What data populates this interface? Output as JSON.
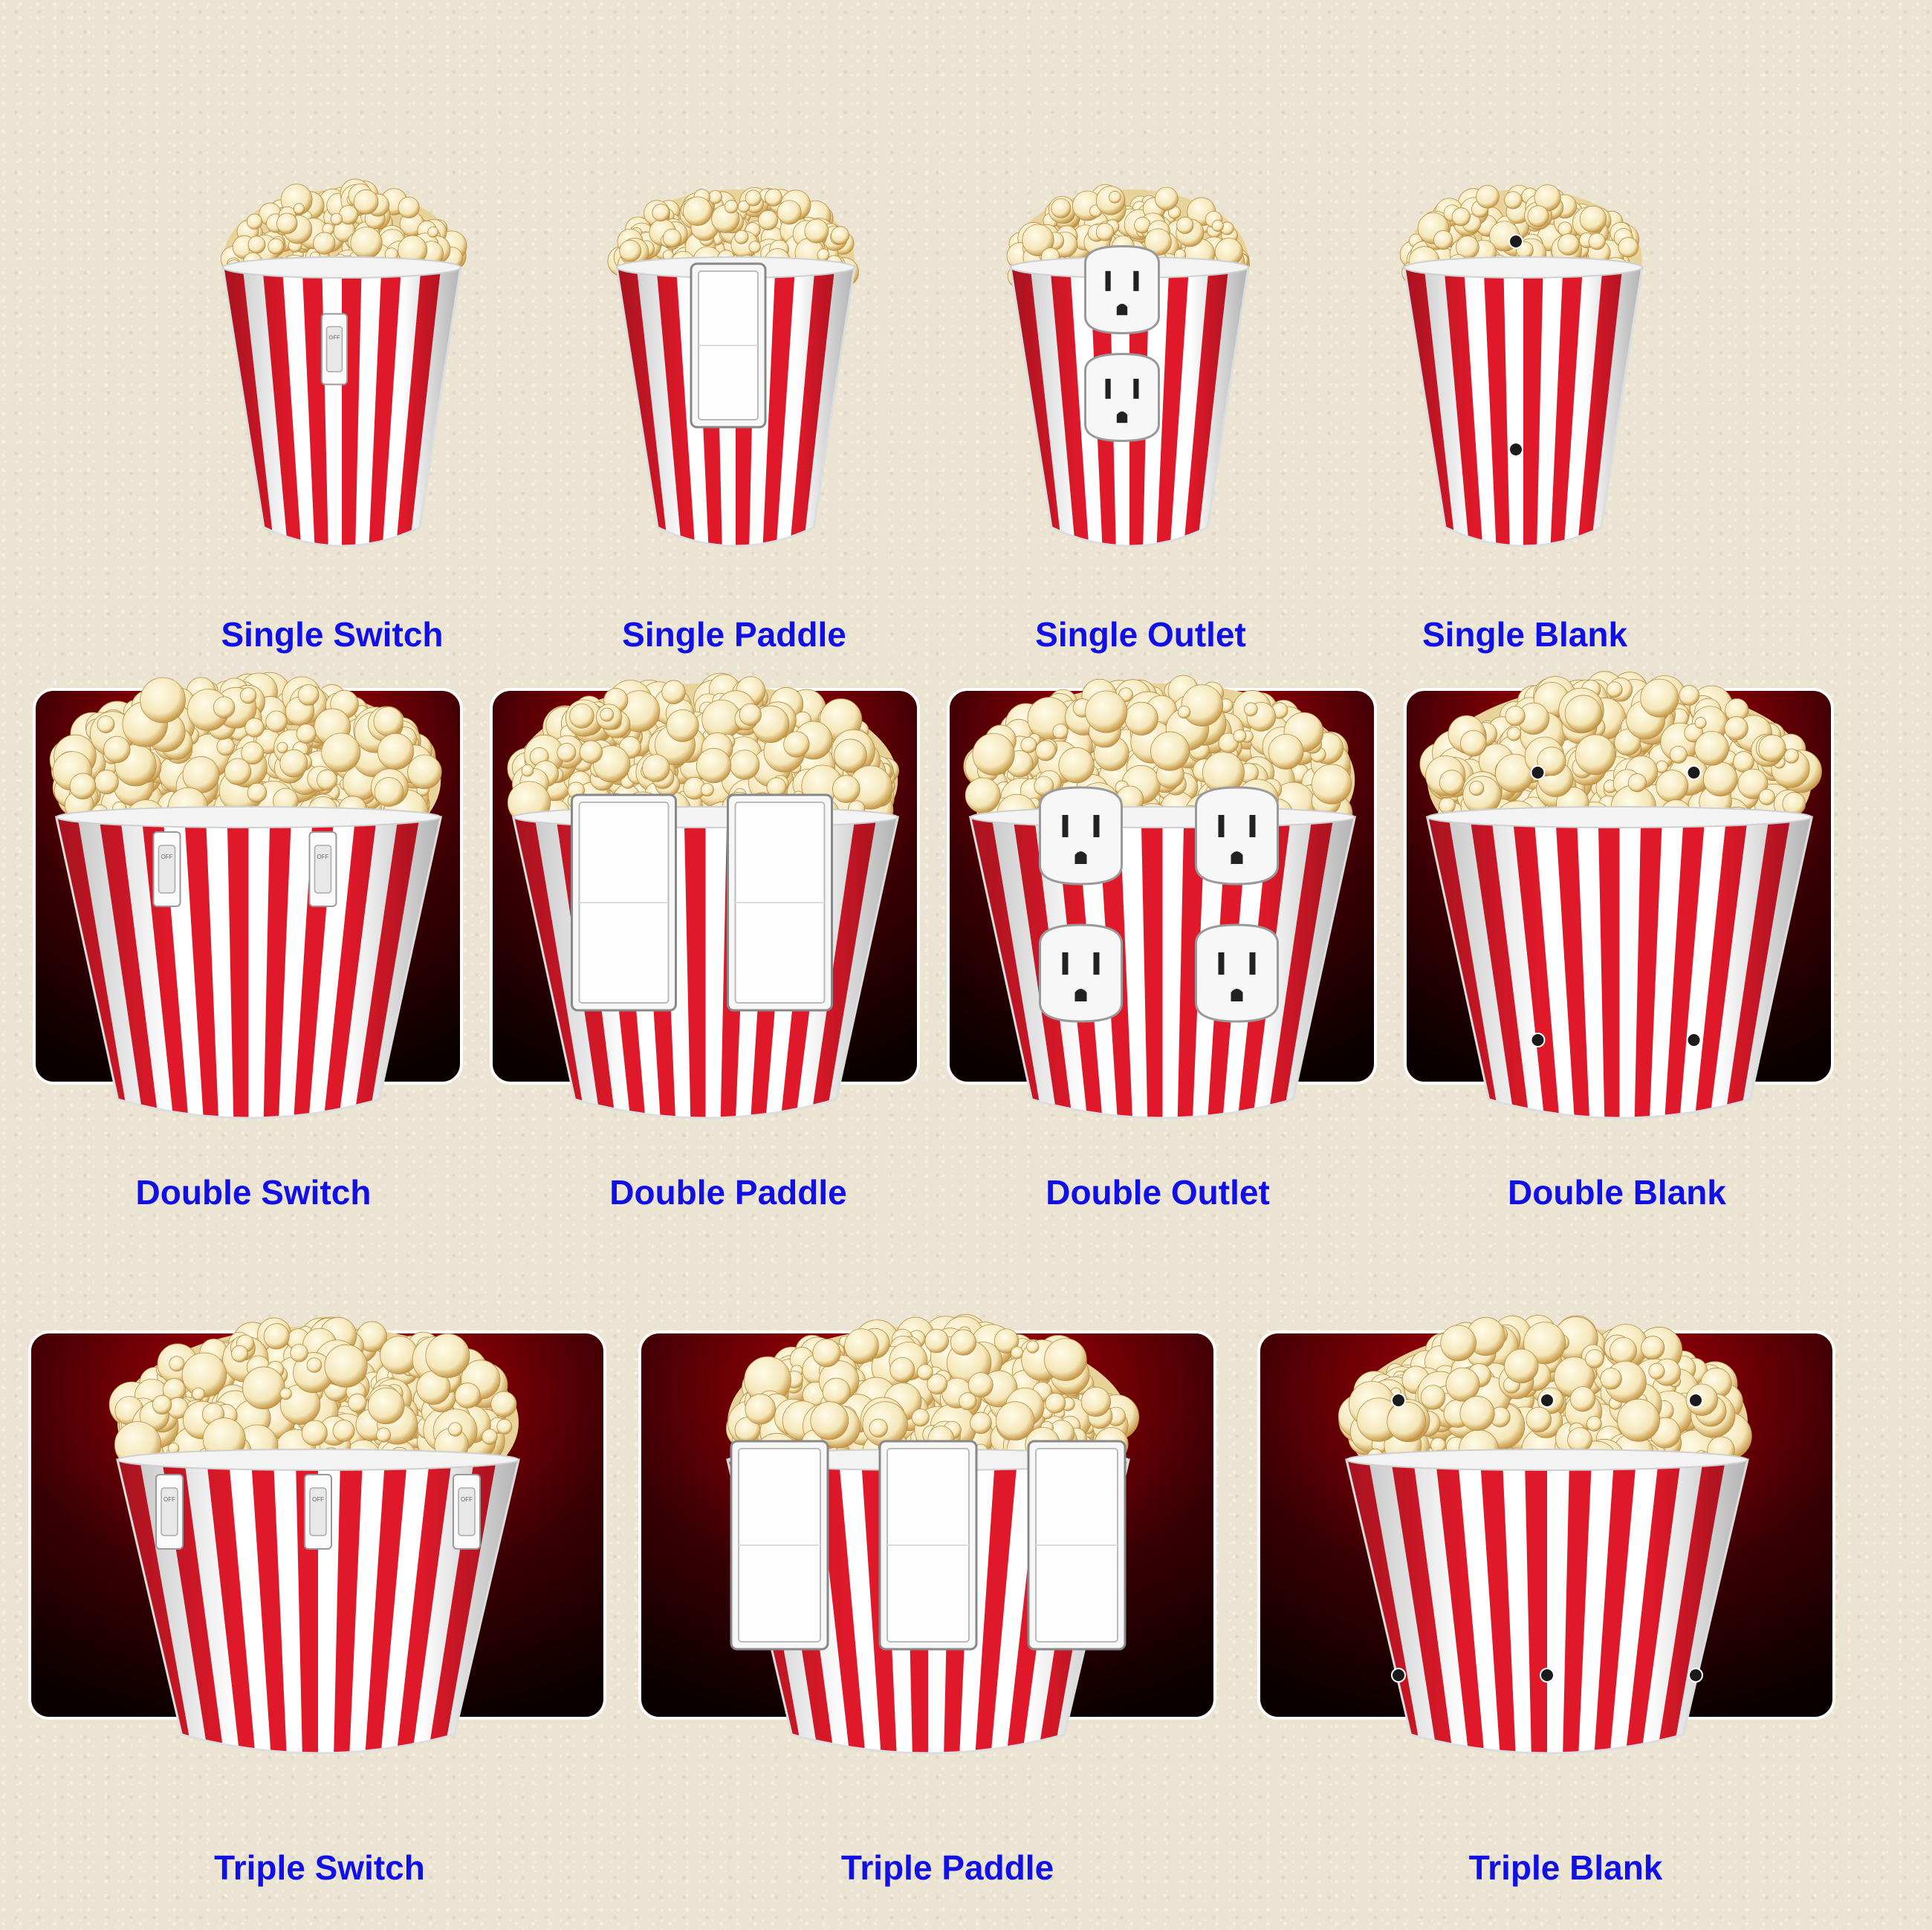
{
  "colors": {
    "label": "#1010e6",
    "stripe_red": "#e0192a",
    "stripe_white": "#ffffff",
    "plate_dark": "#0a0000",
    "plate_red": "#c8000a",
    "popcorn": "#f4e6b8",
    "device_white": "#f7f7f7"
  },
  "rows": [
    {
      "items": [
        {
          "label": "Single Switch",
          "kind": "cup",
          "device": "toggle",
          "count": 1
        },
        {
          "label": "Single Paddle",
          "kind": "cup",
          "device": "paddle",
          "count": 1
        },
        {
          "label": "Single Outlet",
          "kind": "cup",
          "device": "outlet",
          "count": 1
        },
        {
          "label": "Single Blank",
          "kind": "cup",
          "device": "blank",
          "count": 1
        }
      ]
    },
    {
      "items": [
        {
          "label": "Double Switch",
          "kind": "plate",
          "device": "toggle",
          "count": 2
        },
        {
          "label": "Double Paddle",
          "kind": "plate",
          "device": "paddle",
          "count": 2
        },
        {
          "label": "Double Outlet",
          "kind": "plate",
          "device": "outlet",
          "count": 2
        },
        {
          "label": "Double Blank",
          "kind": "plate",
          "device": "blank",
          "count": 2
        }
      ]
    },
    {
      "items": [
        {
          "label": "Triple Switch",
          "kind": "plate",
          "device": "toggle",
          "count": 3
        },
        {
          "label": "Triple Paddle",
          "kind": "plate",
          "device": "paddle",
          "count": 3
        },
        {
          "label": "Triple Blank",
          "kind": "plate",
          "device": "blank",
          "count": 3
        }
      ]
    }
  ],
  "switch_text": "OFF"
}
